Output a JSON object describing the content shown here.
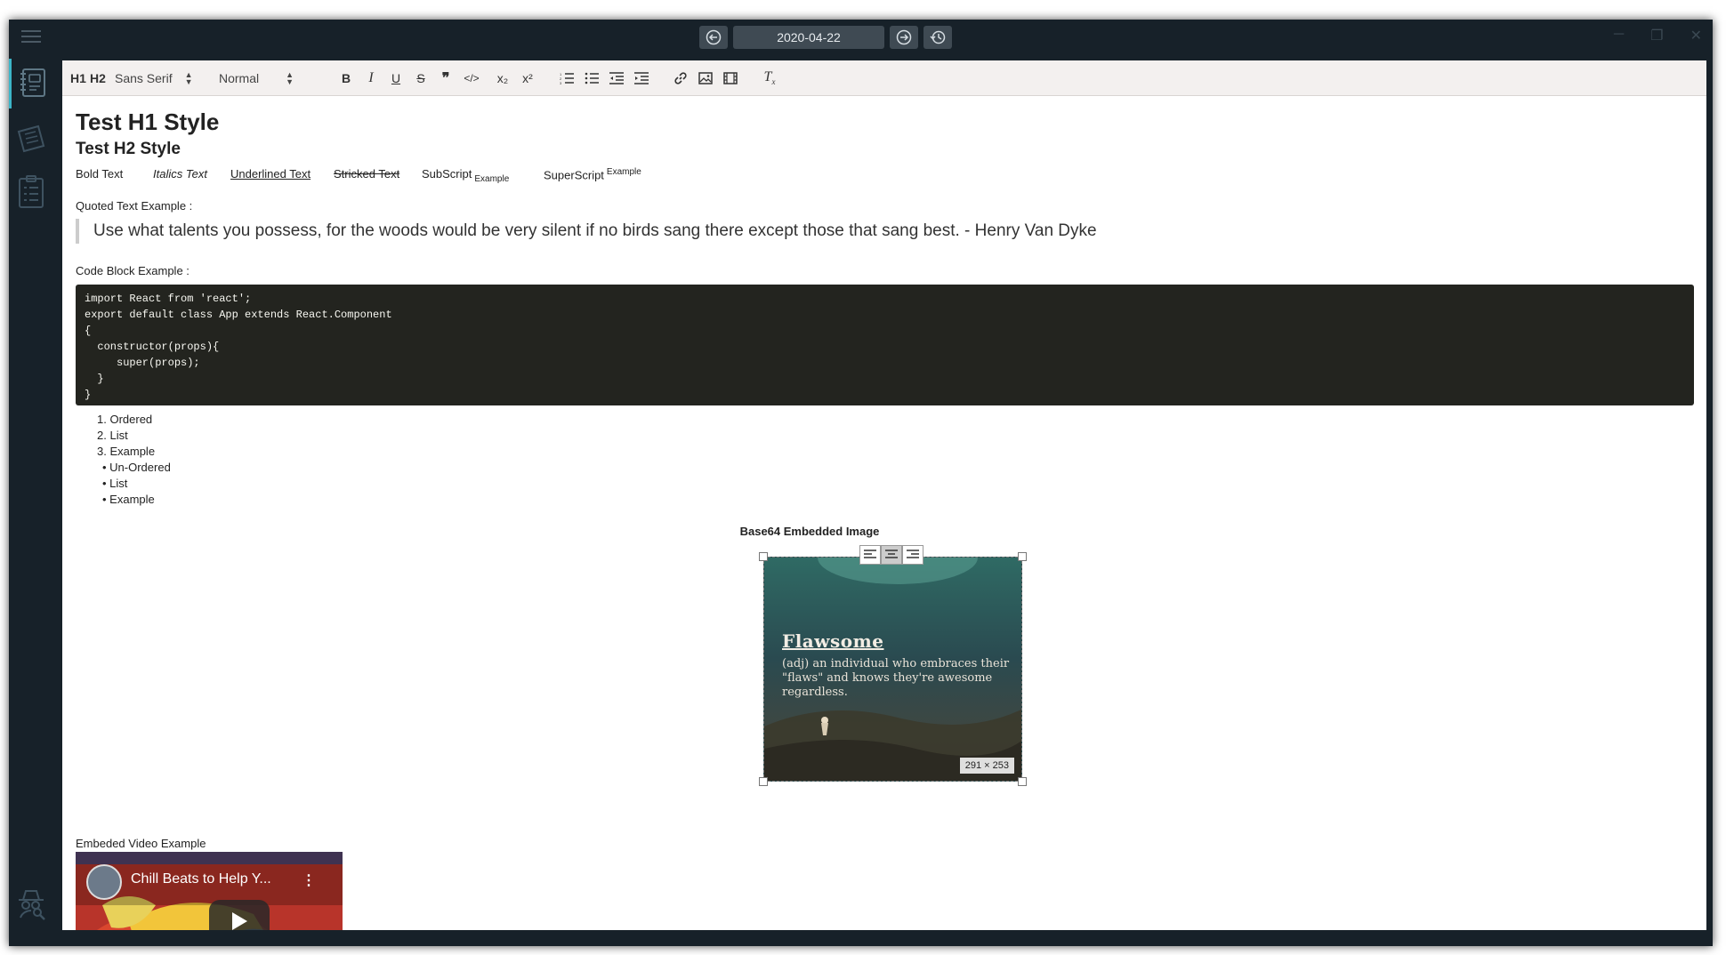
{
  "titlebar": {
    "date": "2020-04-22"
  },
  "toolbar": {
    "h1": "H1",
    "h2": "H2",
    "font": "Sans Serif",
    "size": "Normal",
    "bold": "B",
    "italic": "I",
    "underline": "U",
    "strike": "S",
    "quote": "99",
    "code": "</>",
    "sub": "x₂",
    "sup": "x²",
    "clear": "Tx"
  },
  "content": {
    "h1": "Test H1 Style",
    "h2": "Test H2 Style",
    "formats": {
      "bold": "Bold Text",
      "italic": "Italics Text",
      "underline": "Underlined Text",
      "strike": "Stricked Text",
      "subscript": "SubScript",
      "subscript_small": "Example",
      "superscript": "SuperScript",
      "superscript_small": "Example"
    },
    "quote_label": "Quoted Text Example :",
    "quote": "Use what talents you possess, for the woods would be very silent if no birds sang there except those that sang best. - Henry Van Dyke",
    "code_label": "Code Block Example :",
    "code": "import React from 'react';\nexport default class App extends React.Component\n{\n  constructor(props){\n     super(props);\n  }\n}",
    "ordered_list": [
      "Ordered",
      "List",
      "Example"
    ],
    "unordered_list": [
      "Un-Ordered",
      "List",
      "Example"
    ],
    "image_caption": "Base64 Embedded Image",
    "image": {
      "title": "Flawsome",
      "text": "(adj) an individual who embraces their \"flaws\" and knows they're awesome regardless.",
      "size_label": "291 × 253"
    },
    "video_label": "Embeded Video Example",
    "video_title": "Chill Beats to Help Y..."
  },
  "colors": {
    "sidebar": "#172129",
    "accent": "#3cb6c8",
    "code_bg": "#23241f",
    "toolbar_bg": "#f3f0ef"
  }
}
